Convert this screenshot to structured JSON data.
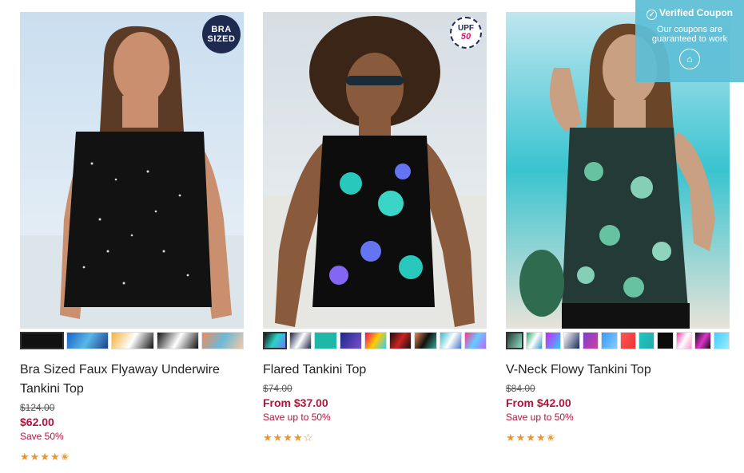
{
  "products": [
    {
      "title": "Bra Sized Faux Flyaway Underwire Tankini Top",
      "was_price": "$124.00",
      "price": "$62.00",
      "save": "Save 50%",
      "badge": [
        "BRA",
        "SIZED"
      ],
      "rating_stars": "★★★★✬"
    },
    {
      "title": "Flared Tankini Top",
      "was_price": "$74.00",
      "price": "From $37.00",
      "save": "Save up to 50%",
      "badge": [
        "UPF",
        "50"
      ],
      "rating_stars": "★★★★☆"
    },
    {
      "title": "V-Neck Flowy Tankini Top",
      "was_price": "$84.00",
      "price": "From $42.00",
      "save": "Save up to 50%",
      "rating_stars": "★★★★✬"
    }
  ],
  "coupon": {
    "title": "Verified Coupon",
    "body": "Our coupons are guaranteed to work",
    "icon": "home-icon"
  },
  "colors": {
    "price_red": "#b3123e",
    "star_orange": "#e8962e",
    "coupon_blue": "#5cbed6",
    "badge_navy": "#1e2a4f"
  }
}
